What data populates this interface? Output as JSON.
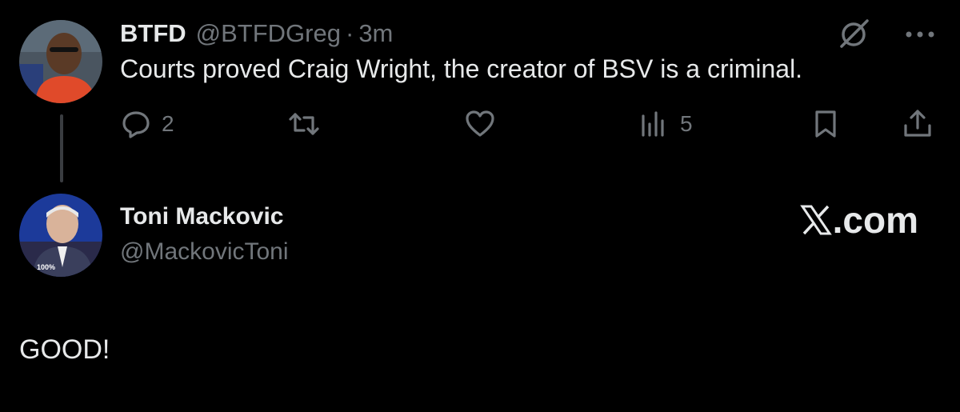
{
  "colors": {
    "background": "#000000",
    "primary_text": "#e7e9ea",
    "secondary_text": "#71767b",
    "thread_line": "#3a3d41"
  },
  "tweet": {
    "avatar_icon": "user-avatar-photo",
    "display_name": "BTFD",
    "handle": "@BTFDGreg",
    "separator": "·",
    "time": "3m",
    "text": "Courts proved Craig Wright, the creator of BSV is a criminal.",
    "top_icons": [
      "grok-icon",
      "more-icon"
    ],
    "actions": {
      "reply": {
        "icon": "reply-icon",
        "count": "2"
      },
      "repost": {
        "icon": "repost-icon",
        "count": ""
      },
      "like": {
        "icon": "heart-icon",
        "count": ""
      },
      "views": {
        "icon": "views-icon",
        "count": "5"
      },
      "bookmark": {
        "icon": "bookmark-icon"
      },
      "share": {
        "icon": "share-icon"
      }
    }
  },
  "reply": {
    "avatar_icon": "user-avatar-photo",
    "avatar_badge": "100%",
    "display_name": "Toni Mackovic",
    "handle": "@MackovicToni",
    "brand": ".com",
    "brand_icon": "x-logo-icon",
    "text": "GOOD!"
  }
}
